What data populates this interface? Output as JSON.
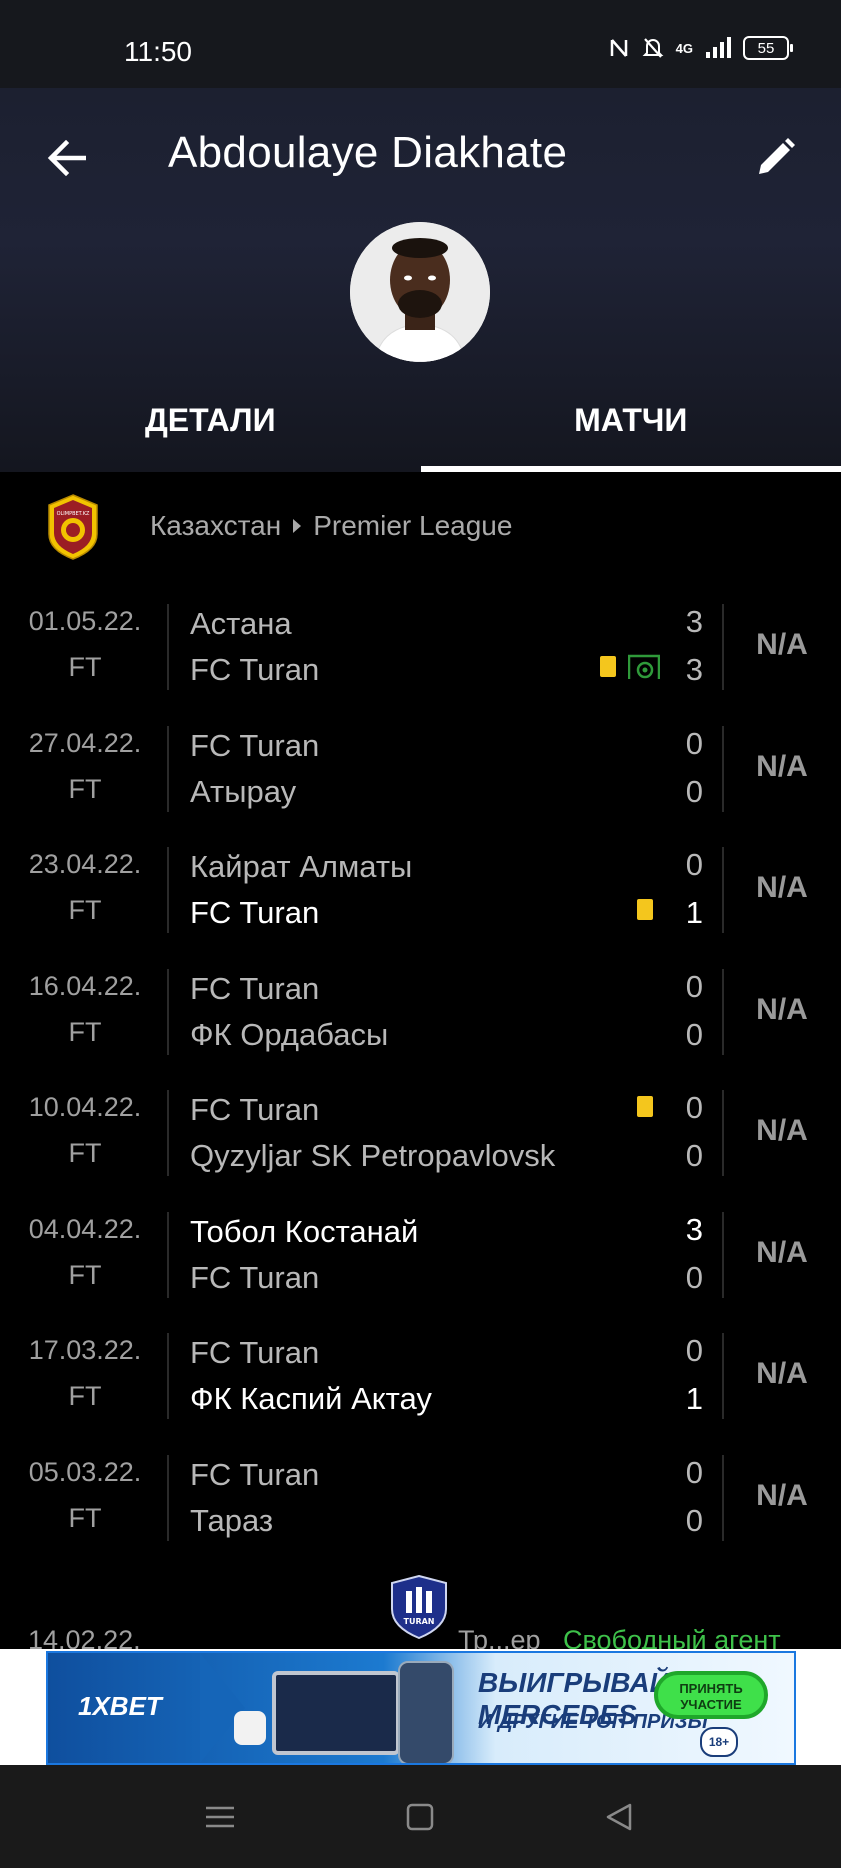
{
  "status_bar": {
    "time": "11:50",
    "network": "4G",
    "battery": "55"
  },
  "header": {
    "title": "Abdoulaye Diakhate",
    "tabs": [
      {
        "label": "ДЕТАЛИ"
      },
      {
        "label": "МАТЧИ"
      }
    ],
    "active_tab": "МАТЧИ"
  },
  "league": {
    "country": "Казахстан",
    "name": "Premier League",
    "logo_text": "OLIMPBET.KZ"
  },
  "matches": [
    {
      "date": "01.05.22.",
      "status": "FT",
      "home": "Астана",
      "away": "FC Turan",
      "home_score": "3",
      "away_score": "3",
      "rating": "N/A"
    },
    {
      "date": "27.04.22.",
      "status": "FT",
      "home": "FC Turan",
      "away": "Атырау",
      "home_score": "0",
      "away_score": "0",
      "rating": "N/A"
    },
    {
      "date": "23.04.22.",
      "status": "FT",
      "home": "Кайрат Алматы",
      "away": "FC Turan",
      "home_score": "0",
      "away_score": "1",
      "rating": "N/A"
    },
    {
      "date": "16.04.22.",
      "status": "FT",
      "home": "FC Turan",
      "away": "ФК Ордабасы",
      "home_score": "0",
      "away_score": "0",
      "rating": "N/A"
    },
    {
      "date": "10.04.22.",
      "status": "FT",
      "home": "FC Turan",
      "away": "Qyzyljar SK Petropavlovsk",
      "home_score": "0",
      "away_score": "0",
      "rating": "N/A"
    },
    {
      "date": "04.04.22.",
      "status": "FT",
      "home": "Тобол Костанай",
      "away": "FC Turan",
      "home_score": "3",
      "away_score": "0",
      "rating": "N/A"
    },
    {
      "date": "17.03.22.",
      "status": "FT",
      "home": "FC Turan",
      "away": "ФК Каспий Актау",
      "home_score": "0",
      "away_score": "1",
      "rating": "N/A"
    },
    {
      "date": "05.03.22.",
      "status": "FT",
      "home": "FC Turan",
      "away": "Тараз",
      "home_score": "0",
      "away_score": "0",
      "rating": "N/A"
    }
  ],
  "transfer": {
    "date": "14.02.22.",
    "from": "Тр...ер",
    "to": "Свободный агент",
    "logo_text": "TURAN"
  },
  "ad": {
    "brand": "1XBET",
    "headline": "ВЫИГРЫВАЙ MERCEDES",
    "subline": "И ДРУГИЕ ТОП-ПРИЗЫ",
    "cta": "ПРИНЯТЬ УЧАСТИЕ",
    "age": "18+"
  },
  "colors": {
    "header_bg": "#1f2336",
    "card_yellow": "#f4c61d",
    "free_agent_green": "#3ec24a",
    "goal_green": "#2f9a3a"
  },
  "icons": {
    "back": "arrow-left-icon",
    "edit": "pencil-icon",
    "card": "yellow-card-icon",
    "goal": "goal-icon"
  }
}
